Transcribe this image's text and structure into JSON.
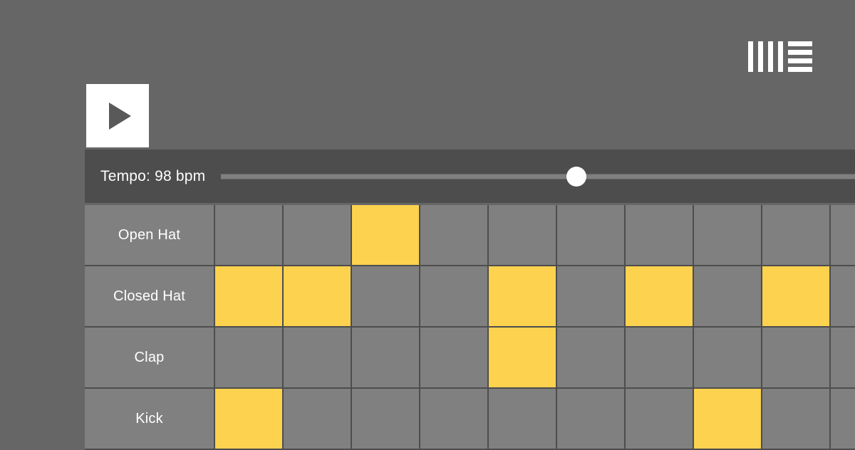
{
  "app": {
    "logo_name": "ableton-live-logo",
    "background_color": "#666666",
    "panel_color": "#4d4d4d",
    "cell_color": "#808080",
    "active_step_color": "#fcd24f"
  },
  "transport": {
    "play_button_label": "Play",
    "play_icon": "play-triangle-icon"
  },
  "tempo": {
    "label": "Tempo: 98 bpm",
    "value": 98,
    "unit": "bpm",
    "slider_percent": 56
  },
  "sequencer": {
    "step_count": 10,
    "tracks": [
      {
        "name": "Open Hat",
        "steps": [
          0,
          0,
          1,
          0,
          0,
          0,
          0,
          0,
          0,
          0
        ]
      },
      {
        "name": "Closed Hat",
        "steps": [
          1,
          1,
          0,
          0,
          1,
          0,
          1,
          0,
          1,
          0
        ]
      },
      {
        "name": "Clap",
        "steps": [
          0,
          0,
          0,
          0,
          1,
          0,
          0,
          0,
          0,
          0
        ]
      },
      {
        "name": "Kick",
        "steps": [
          1,
          0,
          0,
          0,
          0,
          0,
          0,
          1,
          0,
          0
        ]
      }
    ]
  }
}
